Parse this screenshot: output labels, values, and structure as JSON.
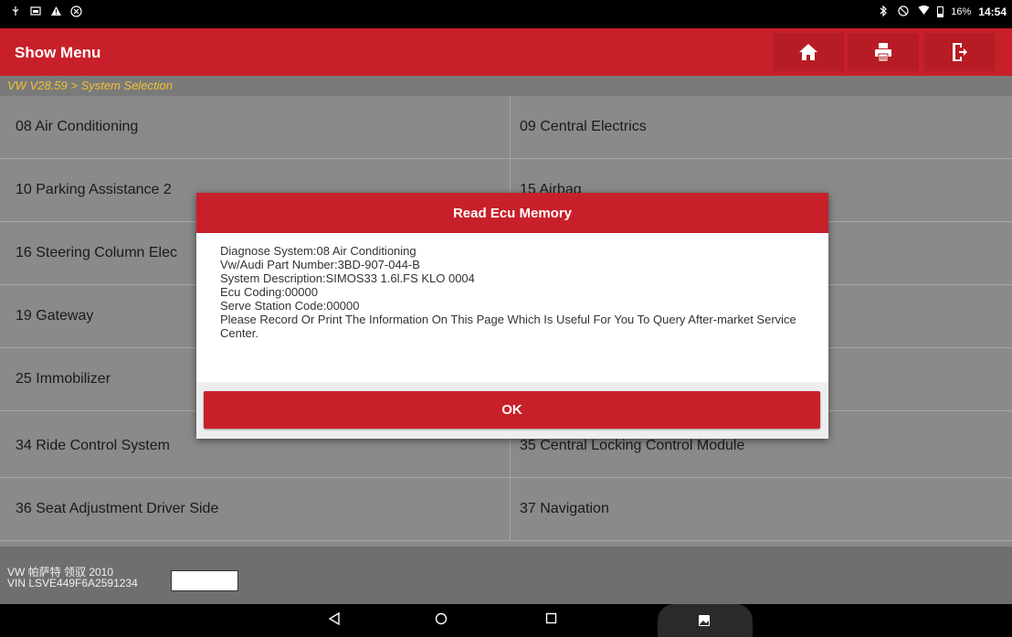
{
  "statusbar": {
    "battery": "16%",
    "time": "14:54",
    "left_icons": [
      "usb-icon",
      "image-icon",
      "warning-icon",
      "app-icon"
    ],
    "right_icons": [
      "bluetooth-icon",
      "dnd-icon",
      "wifi-icon",
      "battery-icon"
    ]
  },
  "header": {
    "title": "Show Menu",
    "buttons": [
      "home-icon",
      "print-icon",
      "exit-icon"
    ]
  },
  "breadcrumb": "VW V28.59 > System Selection",
  "systems": [
    [
      "08 Air Conditioning",
      "09 Central Electrics"
    ],
    [
      "10 Parking Assistance 2",
      "15 Airbag"
    ],
    [
      "16 Steering Column Elec",
      ""
    ],
    [
      "19 Gateway",
      ""
    ],
    [
      "25 Immobilizer",
      ""
    ],
    [
      "34 Ride Control System",
      "35 Central Locking Control Module"
    ],
    [
      "36 Seat Adjustment Driver Side",
      "37 Navigation"
    ]
  ],
  "footer": {
    "vehicle": "VW 帕萨特 领驭 2010",
    "vin": "VIN LSVE449F6A2591234"
  },
  "dialog": {
    "title": "Read Ecu Memory",
    "lines": [
      "Diagnose System:08 Air Conditioning",
      "Vw/Audi Part Number:3BD-907-044-B",
      "System Description:SIMOS33 1.6l.FS KLO 0004",
      "Ecu Coding:00000",
      "Serve Station Code:00000",
      "Please Record Or Print The Information On This Page Which Is Useful For You To Query After-market Service Center."
    ],
    "ok_label": "OK"
  },
  "colors": {
    "brand_red": "#c8202a",
    "breadcrumb_text": "#f2c230",
    "list_bg": "#8a8a8a"
  }
}
